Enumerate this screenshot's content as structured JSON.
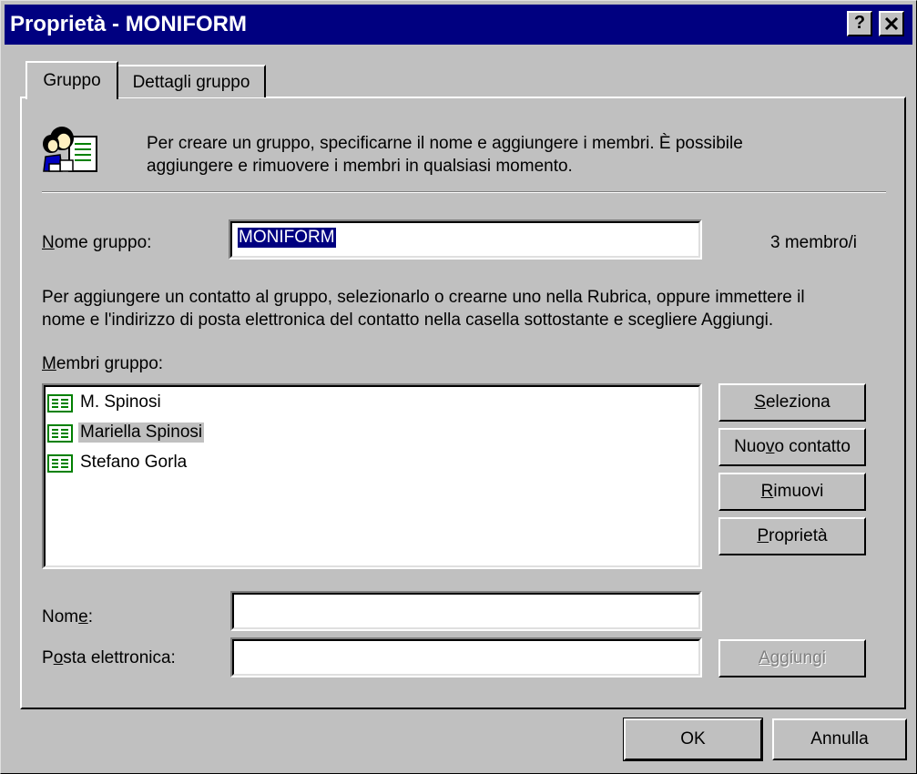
{
  "window": {
    "title": "Proprietà - MONIFORM",
    "help_button": "?",
    "close_button": "✕"
  },
  "tabs": [
    {
      "label": "Gruppo",
      "selected": true
    },
    {
      "label": "Dettagli gruppo",
      "selected": false
    }
  ],
  "intro": {
    "line1": "Per creare un gruppo, specificarne il nome e aggiungere i membri. È possibile",
    "line2": "aggiungere e rimuovere i membri in qualsiasi momento.",
    "icon": "group-people-icon"
  },
  "group_name": {
    "label_pre": "",
    "label_accel": "N",
    "label_post": "ome gruppo:",
    "value": "MONIFORM",
    "member_count": "3 membro/i"
  },
  "instructions": {
    "line1": "Per aggiungere un contatto al gruppo, selezionarlo o crearne uno nella Rubrica, oppure immettere il",
    "line2": "nome e l'indirizzo di posta elettronica del contatto nella casella sottostante e scegliere Aggiungi."
  },
  "members": {
    "label_pre": "",
    "label_accel": "M",
    "label_post": "embri gruppo:",
    "items": [
      {
        "name": "M. Spinosi",
        "icon": "contact-card-icon",
        "selected": false
      },
      {
        "name": "Mariella Spinosi",
        "icon": "contact-card-icon",
        "selected": true
      },
      {
        "name": "Stefano Gorla",
        "icon": "contact-card-icon",
        "selected": false
      }
    ]
  },
  "side_buttons": {
    "select": {
      "pre": "",
      "accel": "S",
      "post": "eleziona"
    },
    "new_contact": {
      "pre": "Nuo",
      "accel": "v",
      "post": "o contatto"
    },
    "remove": {
      "pre": "",
      "accel": "R",
      "post": "imuovi"
    },
    "properties": {
      "pre": "",
      "accel": "P",
      "post": "roprietà"
    }
  },
  "name_field": {
    "pre": "Nom",
    "accel": "e",
    "post": ":",
    "value": ""
  },
  "email_field": {
    "pre": "P",
    "accel": "o",
    "post": "sta elettronica:",
    "value": ""
  },
  "add_button": {
    "pre": "",
    "accel": "A",
    "post": "ggiungi",
    "disabled": true
  },
  "footer": {
    "ok": "OK",
    "cancel": "Annulla"
  },
  "colors": {
    "titlebar": "#000080",
    "face": "#c0c0c0",
    "selection": "#000080"
  }
}
